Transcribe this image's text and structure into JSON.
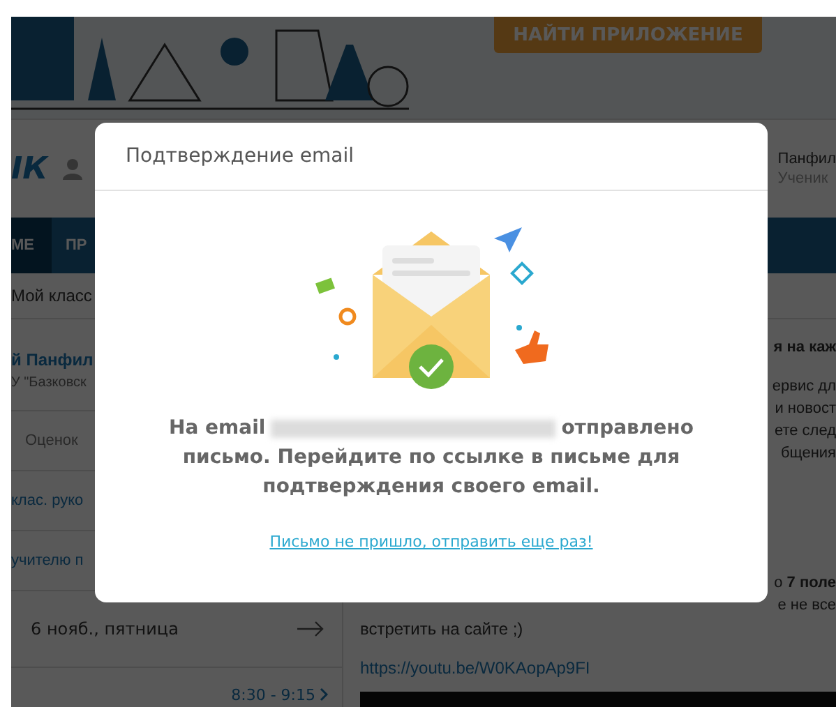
{
  "banner": {
    "button": "НАЙТИ ПРИЛОЖЕНИЕ"
  },
  "header": {
    "logo": "ІК",
    "user_name": "Панфил",
    "user_role": "Ученик"
  },
  "nav": {
    "items": [
      {
        "label": "МЕ",
        "selected": true
      },
      {
        "label": "ПР",
        "selected": false
      }
    ]
  },
  "breadcrumb": "Мой класс",
  "sidebar": {
    "name": "й Панфил",
    "school": "У \"Базковск",
    "items": [
      "Оценок",
      "клас. руко",
      "учителю п"
    ],
    "date": "6 нояб., пятница",
    "time": "8:30 - 9:15"
  },
  "content": {
    "lines": [
      {
        "text": "я на каж",
        "bold": true
      },
      {
        "text": "ервис дл",
        "bold": false
      },
      {
        "text": "и новост",
        "bold": false
      },
      {
        "text": "ете след",
        "bold": false
      },
      {
        "text": "бщения",
        "bold": false
      },
      {
        "text": "о **7 поле**",
        "bold": false
      },
      {
        "text": "е не все",
        "bold": false
      }
    ],
    "tail": "встретить на сайте ;)",
    "link": "https://youtu.be/W0KAopAp9FI"
  },
  "dialog": {
    "title": "Подтверждение email",
    "message_start": "На email",
    "message_end": "отправлено письмо. Перейдите по ссылке в письме для подтверждения своего email.",
    "resend_link": "Письмо не пришло, отправить еще раз!"
  }
}
